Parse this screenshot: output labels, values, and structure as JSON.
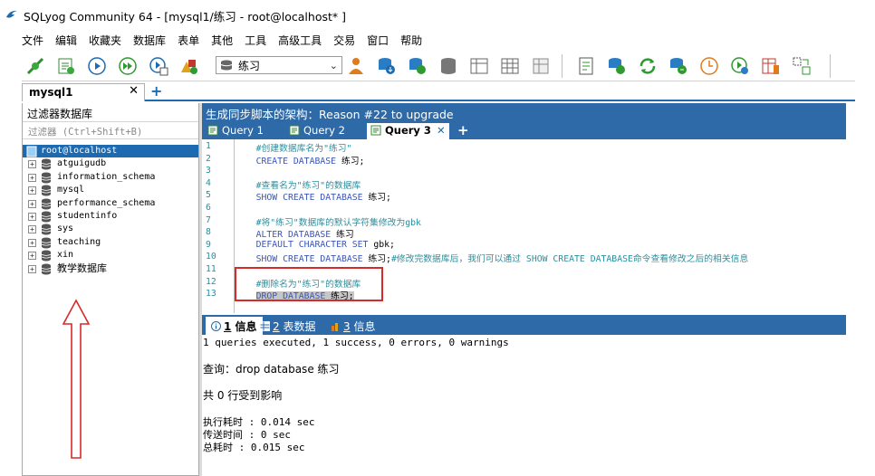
{
  "window": {
    "title": "SQLyog Community 64 - [mysql1/练习 - root@localhost* ]"
  },
  "menu": [
    "文件",
    "编辑",
    "收藏夹",
    "数据库",
    "表单",
    "其他",
    "工具",
    "高级工具",
    "交易",
    "窗口",
    "帮助"
  ],
  "toolbar": {
    "db_selector": "练习"
  },
  "connection_tab": {
    "label": "mysql1",
    "close": "✕",
    "add": "+"
  },
  "left": {
    "filter_label": "过滤器数据库",
    "filter_placeholder": "过滤器 (Ctrl+Shift+B)",
    "root": "root@localhost",
    "databases": [
      "atguigudb",
      "information_schema",
      "mysql",
      "performance_schema",
      "studentinfo",
      "sys",
      "teaching",
      "xin",
      "教学数据库"
    ]
  },
  "right": {
    "schema_header": "生成同步脚本的架构：Reason #22 to upgrade",
    "query_tabs": [
      "Query 1",
      "Query 2",
      "Query 3"
    ],
    "active_query_tab": "Query 3",
    "tab_close": "✕",
    "tab_add": "+"
  },
  "editor": {
    "lines": [
      {
        "n": "1",
        "parts": [
          {
            "t": "    #创建数据库名为\"练习\"",
            "c": "cm"
          }
        ]
      },
      {
        "n": "2",
        "parts": [
          {
            "t": "    CREATE DATABASE ",
            "c": "kw"
          },
          {
            "t": "练习;",
            "c": "tx"
          }
        ]
      },
      {
        "n": "3",
        "parts": []
      },
      {
        "n": "4",
        "parts": [
          {
            "t": "    #查看名为\"练习\"的数据库",
            "c": "cm"
          }
        ]
      },
      {
        "n": "5",
        "parts": [
          {
            "t": "    SHOW CREATE DATABASE ",
            "c": "kw"
          },
          {
            "t": "练习;",
            "c": "tx"
          }
        ]
      },
      {
        "n": "6",
        "parts": []
      },
      {
        "n": "7",
        "parts": [
          {
            "t": "    #将\"练习\"数据库的默认字符集修改为gbk",
            "c": "cm"
          }
        ]
      },
      {
        "n": "8",
        "parts": [
          {
            "t": "    ALTER DATABASE ",
            "c": "kw"
          },
          {
            "t": "练习",
            "c": "tx"
          }
        ]
      },
      {
        "n": "9",
        "parts": [
          {
            "t": "    DEFAULT CHARACTER SET ",
            "c": "kw"
          },
          {
            "t": "gbk;",
            "c": "tx"
          }
        ]
      },
      {
        "n": "10",
        "parts": [
          {
            "t": "    SHOW CREATE DATABASE ",
            "c": "kw"
          },
          {
            "t": "练习;",
            "c": "tx"
          },
          {
            "t": "#修改完数据库后，我们可以通过 SHOW CREATE DATABASE命令查看修改之后的相关信息",
            "c": "cm"
          }
        ]
      },
      {
        "n": "11",
        "parts": []
      },
      {
        "n": "12",
        "parts": [
          {
            "t": "    #删除名为\"练习\"的数据库",
            "c": "cm"
          }
        ]
      },
      {
        "n": "13",
        "parts": [
          {
            "t": "    ",
            "c": "tx"
          },
          {
            "t": "DROP DATABASE ",
            "c": "kw hl"
          },
          {
            "t": "练习;",
            "c": "tx hl"
          }
        ]
      }
    ]
  },
  "result_tabs": [
    {
      "num": "1",
      "label": "信息"
    },
    {
      "num": "2",
      "label": "表数据"
    },
    {
      "num": "3",
      "label": "信息"
    }
  ],
  "results": {
    "summary": "1 queries executed, 1 success, 0 errors, 0 warnings",
    "query": "查询：drop database 练习",
    "affected": "共 0 行受到影响",
    "exec_time": "执行耗时   : 0.014 sec",
    "transfer_time": "传送时间   : 0 sec",
    "total_time": "总耗时     : 0.015 sec"
  }
}
